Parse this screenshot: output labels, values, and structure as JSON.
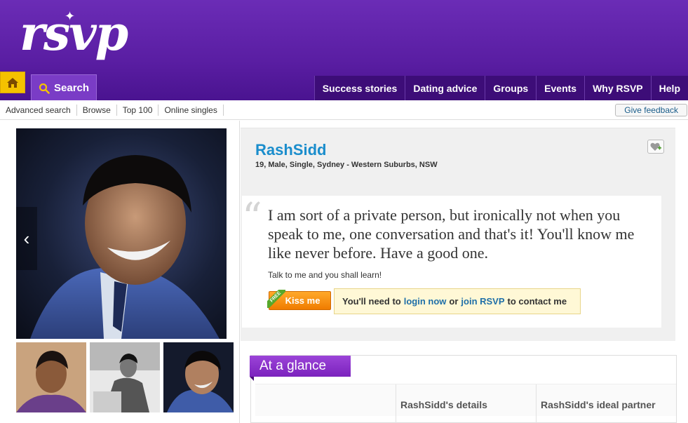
{
  "brand": {
    "logo_text": "rsvp"
  },
  "nav": {
    "search_label": "Search",
    "top_items": [
      "Success stories",
      "Dating advice",
      "Groups",
      "Events",
      "Why RSVP",
      "Help"
    ]
  },
  "subnav": {
    "links": [
      "Advanced search",
      "Browse",
      "Top 100",
      "Online singles"
    ],
    "feedback_label": "Give feedback"
  },
  "profile": {
    "username": "RashSidd",
    "summary": "19, Male, Single, Sydney - Western Suburbs, NSW",
    "quote": "I am sort of a private person, but ironically not when you speak to me, one conversation and that's it! You'll know me like never before. Have a good one.",
    "tagline": "Talk to me and you shall learn!",
    "kiss_label": "Kiss me",
    "free_badge": "FREE",
    "contact": {
      "prefix": "You'll need to",
      "login_link": "login now",
      "middle": "or",
      "join_link": "join RSVP",
      "suffix": "to contact me"
    }
  },
  "glance": {
    "title": "At a glance",
    "col_details": "RashSidd's details",
    "col_partner": "RashSidd's ideal partner"
  },
  "colors": {
    "header_purple": "#5a1ea3",
    "accent_orange": "#f07c00",
    "link_blue": "#1a8dcc",
    "home_yellow": "#f5c200"
  }
}
